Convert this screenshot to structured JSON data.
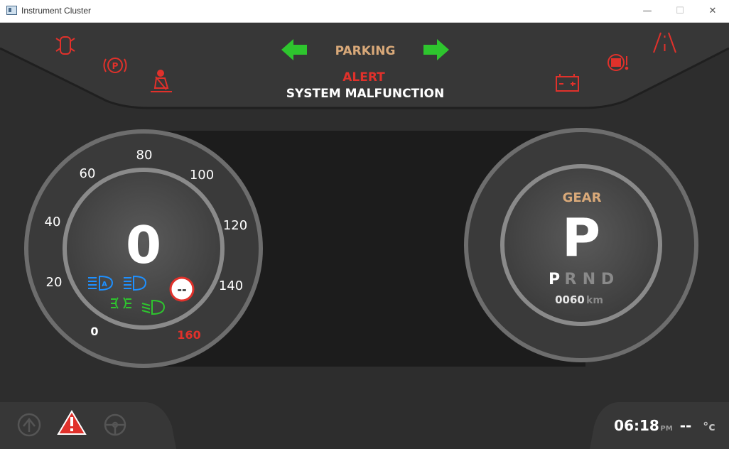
{
  "window": {
    "title": "Instrument Cluster",
    "controls": [
      "—",
      "☐",
      "✕"
    ]
  },
  "top_panel": {
    "status": "PARKING",
    "alert": "ALERT",
    "message": "SYSTEM MALFUNCTION"
  },
  "speedometer": {
    "speed": "0",
    "ticks": [
      "0",
      "20",
      "40",
      "60",
      "80",
      "100",
      "120",
      "140",
      "160"
    ],
    "speed_limit": "--"
  },
  "gear_panel": {
    "label": "GEAR",
    "current": "P",
    "options": [
      "P",
      "R",
      "N",
      "D"
    ],
    "odometer": "0060",
    "odometer_unit": "km"
  },
  "bottom_bar": {
    "time": "06:18",
    "ampm": "PM",
    "temp": "--",
    "temp_unit": "°c"
  },
  "colors": {
    "warning_red": "#e0312b",
    "indicator_green": "#2ec52e",
    "headlight_blue": "#1e90ff",
    "accent_tan": "#d9a979"
  }
}
